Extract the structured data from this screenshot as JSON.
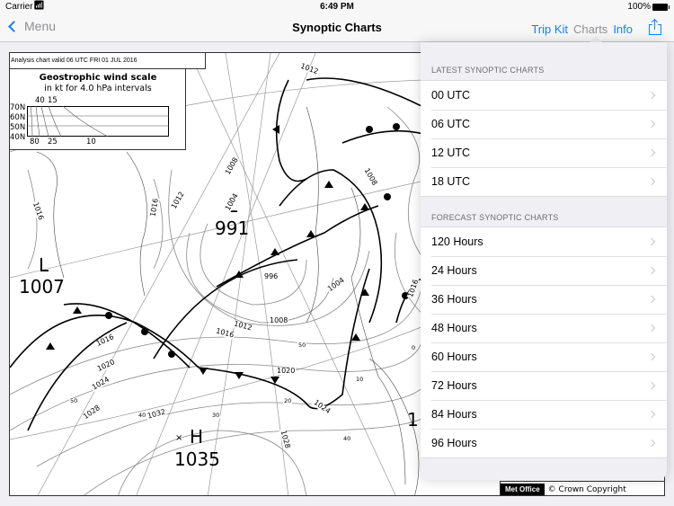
{
  "status_bar": {
    "carrier": "Carrier",
    "wifi_icon": "wifi-icon",
    "time": "6:49 PM",
    "battery_percent": "100%",
    "battery_icon": "battery-icon"
  },
  "nav_bar": {
    "back_label": "Menu",
    "title": "Synoptic Charts",
    "actions": [
      {
        "label": "Trip Kit",
        "active": true
      },
      {
        "label": "Charts",
        "active": false
      },
      {
        "label": "Info",
        "active": true
      }
    ],
    "share_icon": "share-icon",
    "accent_color": "#147efb"
  },
  "chart": {
    "header_text": "Analysis chart  valid 06 UTC FRI 01  JUL 2016",
    "wind_scale": {
      "title": "Geostrophic wind scale",
      "subtitle": "in kt for 4.0 hPa intervals",
      "latitudes": [
        "70N",
        "60N",
        "50N",
        "40N"
      ],
      "top_values": [
        "40",
        "15"
      ],
      "bottom_values": [
        "80",
        "25",
        "10"
      ]
    },
    "pressure_systems": [
      {
        "type": "L",
        "value": "1007"
      },
      {
        "type": "L",
        "value": "991"
      },
      {
        "type": "H",
        "value": "1035"
      },
      {
        "type": "",
        "value": "1"
      }
    ],
    "isobar_labels": [
      "1016",
      "1016",
      "1012",
      "1008",
      "1004",
      "1012",
      "1008",
      "996",
      "1008",
      "1012",
      "1016",
      "1004",
      "1016",
      "1012",
      "1016",
      "1020",
      "1024",
      "1028",
      "1032",
      "1020",
      "1028",
      "1024",
      "1016",
      "1012"
    ],
    "grid_labels": [
      "50",
      "40",
      "30",
      "50",
      "20",
      "10",
      "40",
      "0"
    ],
    "footer": {
      "logo_text": "Met Office",
      "copyright": "© Crown Copyright"
    }
  },
  "popover": {
    "sections": [
      {
        "header": "LATEST SYNOPTIC CHARTS",
        "items": [
          "00 UTC",
          "06 UTC",
          "12 UTC",
          "18 UTC"
        ]
      },
      {
        "header": "FORECAST SYNOPTIC CHARTS",
        "items": [
          "120 Hours",
          "24 Hours",
          "36 Hours",
          "48 Hours",
          "60 Hours",
          "72 Hours",
          "84 Hours",
          "96 Hours"
        ]
      }
    ]
  }
}
